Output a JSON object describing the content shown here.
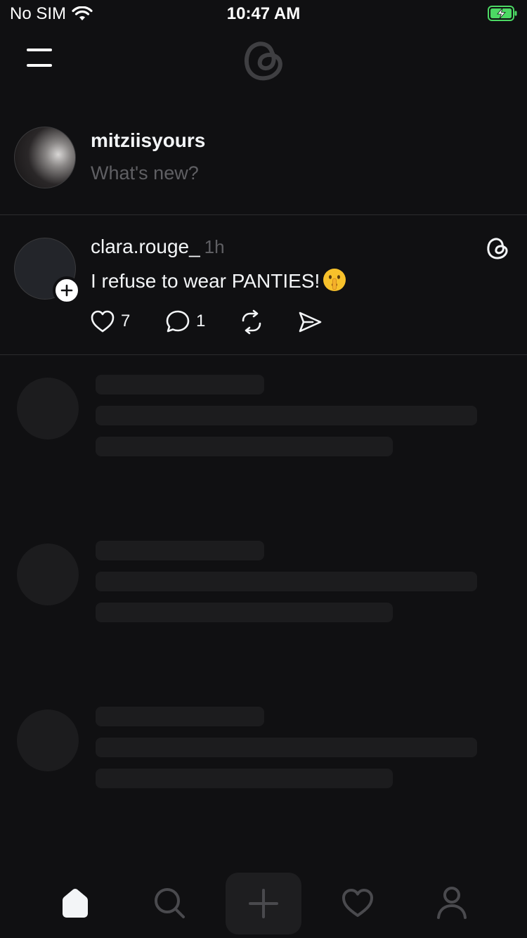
{
  "status_bar": {
    "carrier": "No SIM",
    "time": "10:47 AM"
  },
  "composer": {
    "username": "mitziisyours",
    "placeholder": "What's new?"
  },
  "post": {
    "username": "clara.rouge_",
    "time": "1h",
    "text": "I refuse to wear PANTIES!",
    "emoji_icon": "shushing-face-emoji",
    "likes": "7",
    "replies": "1"
  },
  "tabs": [
    "home-icon",
    "search-icon",
    "plus-icon",
    "heart-icon",
    "profile-icon"
  ],
  "colors": {
    "background": "#101012",
    "text": "#f3f5f7",
    "muted": "#5f5f63",
    "skeleton": "#1c1c1e",
    "battery": "#4cd964"
  }
}
